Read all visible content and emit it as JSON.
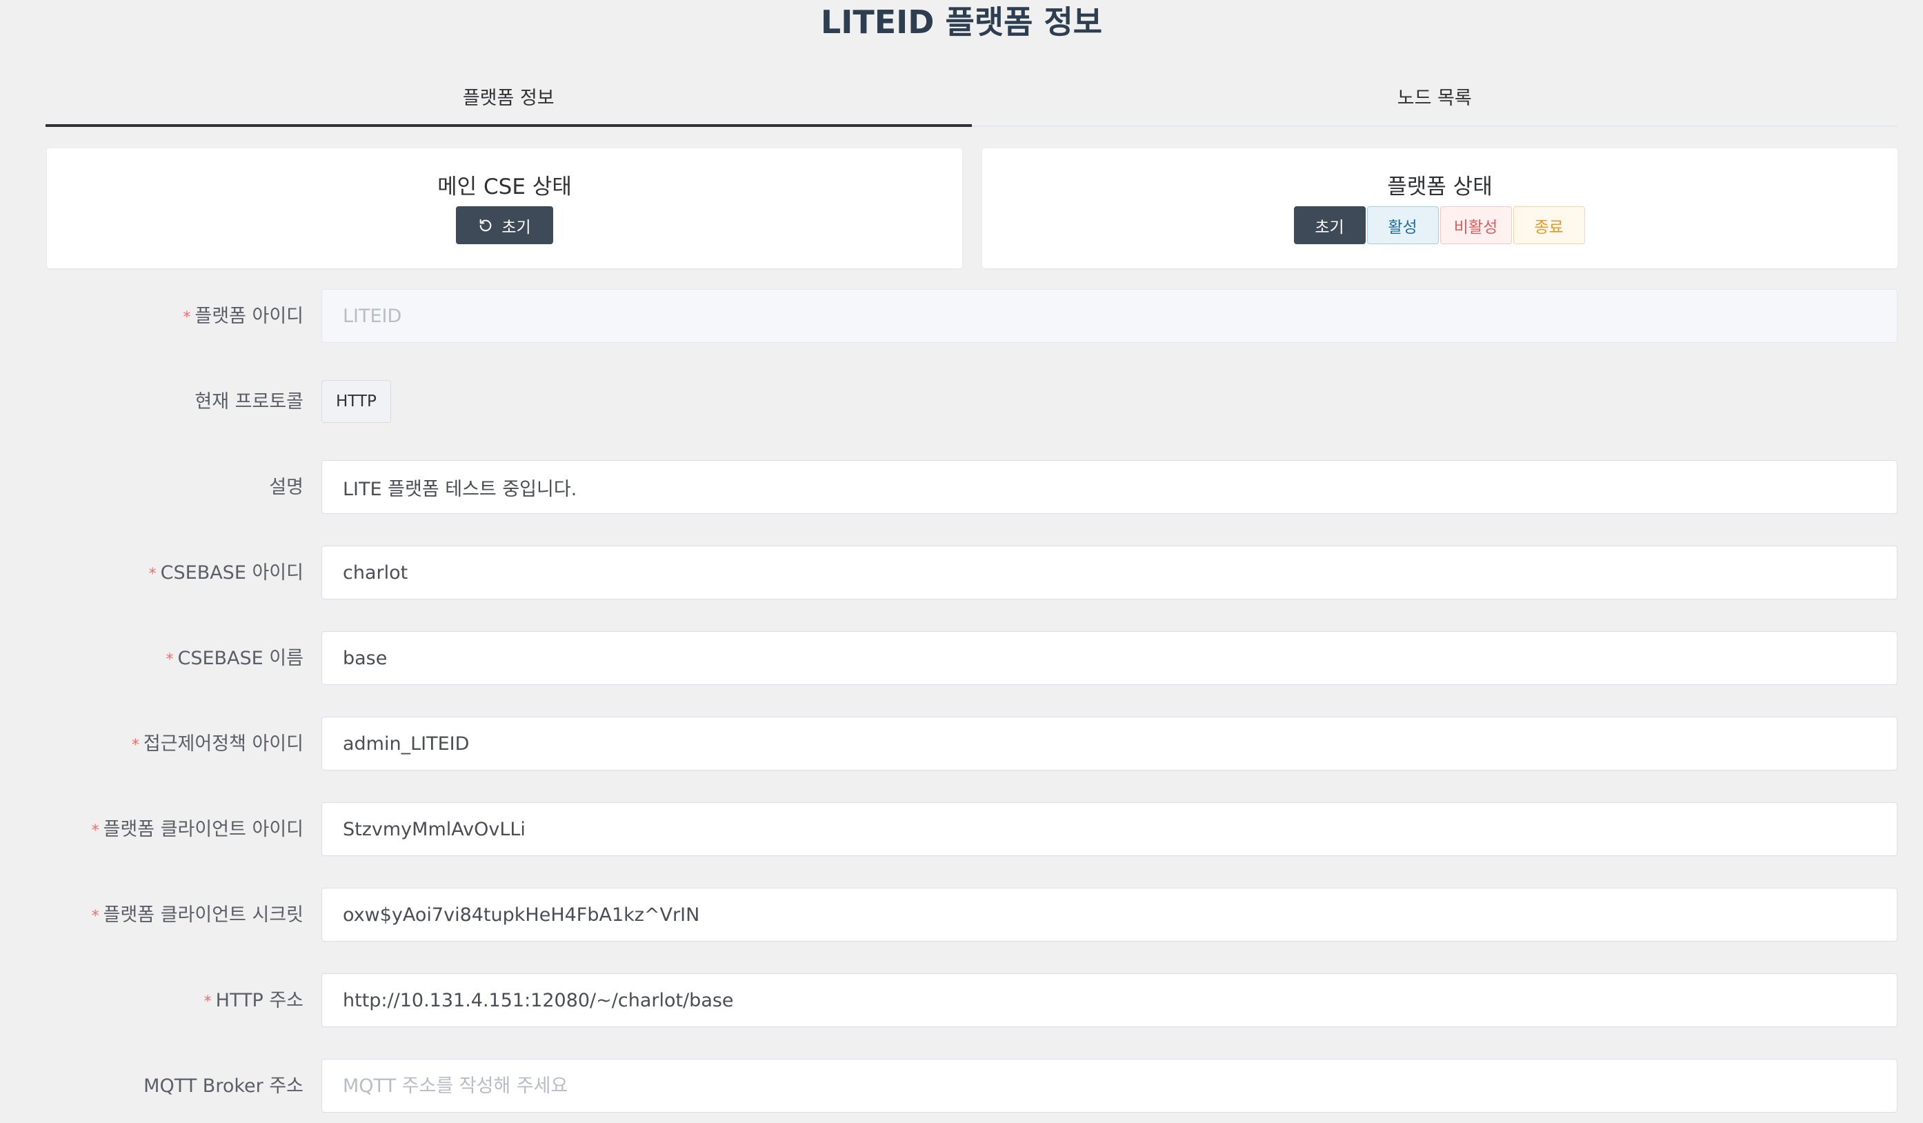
{
  "page": {
    "title": "LITEID 플랫폼 정보"
  },
  "tabs": [
    {
      "label": "플랫폼 정보",
      "active": true
    },
    {
      "label": "노드 목록",
      "active": false
    }
  ],
  "main_cse": {
    "title": "메인 CSE 상태",
    "reset_button_label": "초기",
    "reset_icon": "refresh-icon"
  },
  "platform_status": {
    "title": "플랫폼 상태",
    "options": [
      {
        "label": "초기",
        "selected": true,
        "color": "#3e4a57"
      },
      {
        "label": "활성",
        "selected": false,
        "color": "#1d6fa0"
      },
      {
        "label": "비활성",
        "selected": false,
        "color": "#e25c5c"
      },
      {
        "label": "종료",
        "selected": false,
        "color": "#e49a2f"
      }
    ]
  },
  "form": {
    "platform_id": {
      "label": "플랫폼 아이디",
      "required": "*",
      "value": "",
      "placeholder": "LITEID"
    },
    "protocol": {
      "label": "현재 프로토콜",
      "value": "HTTP"
    },
    "description": {
      "label": "설명",
      "value": "LITE 플랫폼 테스트 중입니다."
    },
    "csebase_id": {
      "label": "CSEBASE 아이디",
      "required": "*",
      "value": "charlot"
    },
    "csebase_name": {
      "label": "CSEBASE 이름",
      "required": "*",
      "value": "base"
    },
    "acp_id": {
      "label": "접근제어정책 아이디",
      "required": "*",
      "value": "admin_LITEID"
    },
    "client_id": {
      "label": "플랫폼 클라이언트 아이디",
      "required": "*",
      "value": "StzvmyMmlAvOvLLi"
    },
    "client_secret": {
      "label": "플랫폼 클라이언트 시크릿",
      "required": "*",
      "value": "oxw$yAoi7vi84tupkHeH4FbA1kz^VrIN"
    },
    "http_address": {
      "label": "HTTP 주소",
      "required": "*",
      "value": "http://10.131.4.151:12080/~/charlot/base"
    },
    "mqtt_address": {
      "label": "MQTT Broker 주소",
      "value": "",
      "placeholder": "MQTT 주소를 작성해 주세요"
    }
  }
}
